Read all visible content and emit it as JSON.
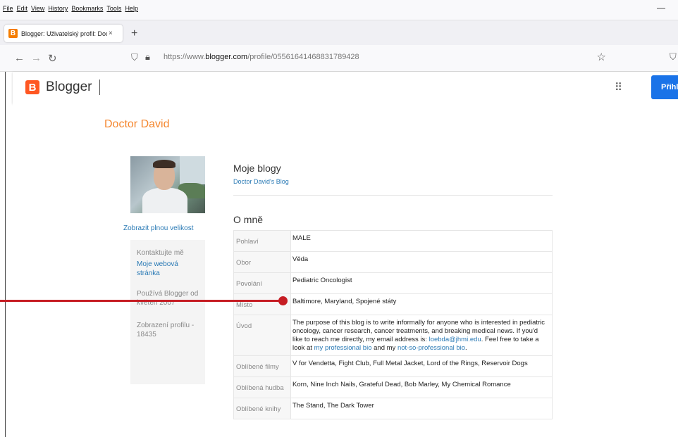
{
  "browser": {
    "menu": [
      "File",
      "Edit",
      "View",
      "History",
      "Bookmarks",
      "Tools",
      "Help"
    ],
    "minimize": "—",
    "tab_title": "Blogger: Uživatelský profil: Doct",
    "tab_close": "×",
    "new_tab": "+",
    "url_host_prefix": "https://www.",
    "url_host": "blogger.com",
    "url_path": "/profile/05561641468831789428"
  },
  "header": {
    "logo_letter": "B",
    "brand": "Blogger",
    "signin_label": "Přihlásit"
  },
  "profile": {
    "name": "Doctor David",
    "fullsize_link": "Zobrazit plnou velikost",
    "contact_label": "Kontaktujte mě",
    "website_link": "Moje webová stránka",
    "uses_blogger": "Používá Blogger od květen 2007",
    "views": "Zobrazení profilu - 18435"
  },
  "blogs": {
    "heading": "Moje blogy",
    "items": [
      "Doctor David's Blog"
    ]
  },
  "about": {
    "heading": "O mně",
    "rows": [
      {
        "label": "Pohlaví",
        "value": "MALE"
      },
      {
        "label": "Obor",
        "value": "Věda"
      },
      {
        "label": "Povolání",
        "value": "Pediatric Oncologist"
      },
      {
        "label": "Místo",
        "value": "Baltimore, Maryland, Spojené státy"
      },
      {
        "label": "Úvod",
        "intro_1": "The purpose of this blog is to write informally for anyone who is interested in pediatric oncology, cancer research, cancer treatments, and breaking medical news. If you'd like to reach me directly, my email address is: ",
        "email": "loebda@jhmi.edu",
        "intro_2": ". Feel free to take a look at ",
        "bio_link_1": "my professional bio",
        "intro_3": " and my ",
        "bio_link_2": "not-so-professional bio",
        "intro_4": "."
      },
      {
        "label": "Oblíbené filmy",
        "value": "V for Vendetta, Fight Club, Full Metal Jacket, Lord of the Rings, Reservoir Dogs"
      },
      {
        "label": "Oblíbená hudba",
        "value": "Korn, Nine Inch Nails, Grateful Dead, Bob Marley, My Chemical Romance"
      },
      {
        "label": "Oblíbené knihy",
        "value": "The Stand, The Dark Tower"
      }
    ]
  },
  "colors": {
    "title_orange": "#f5872f",
    "link_blue": "#2a7ab5",
    "signin_blue": "#1a73e8",
    "annotation_red": "#c61d24"
  }
}
